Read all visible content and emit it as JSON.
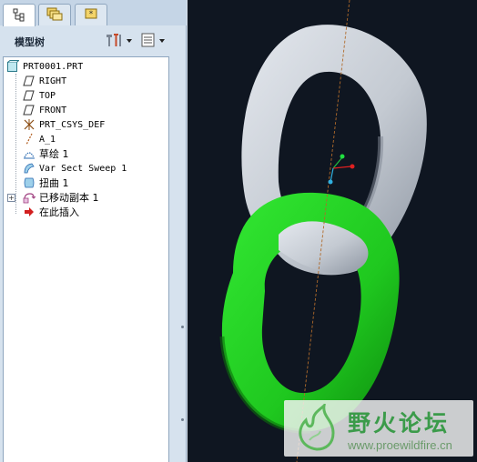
{
  "panel": {
    "title": "模型树",
    "tabs": [
      {
        "name": "model-tree-tab",
        "icon": "tree-icon"
      },
      {
        "name": "folder-browser-tab",
        "icon": "folders-icon"
      },
      {
        "name": "favorites-tab",
        "icon": "star-icon"
      }
    ]
  },
  "tree": {
    "items": [
      {
        "label": "PRT0001.PRT",
        "icon": "part-icon"
      },
      {
        "label": "RIGHT",
        "icon": "datum-plane-icon"
      },
      {
        "label": "TOP",
        "icon": "datum-plane-icon"
      },
      {
        "label": "FRONT",
        "icon": "datum-plane-icon"
      },
      {
        "label": "PRT_CSYS_DEF",
        "icon": "coordinate-system-icon"
      },
      {
        "label": "A_1",
        "icon": "datum-axis-icon"
      },
      {
        "label": "草绘 1",
        "icon": "sketch-icon"
      },
      {
        "label": "Var Sect Sweep 1",
        "icon": "sweep-icon"
      },
      {
        "label": "扭曲 1",
        "icon": "warp-icon"
      },
      {
        "label": "已移动副本 1",
        "icon": "moved-copy-icon"
      },
      {
        "label": "在此插入",
        "icon": "insert-here-arrow-icon"
      }
    ],
    "expander": "+"
  },
  "viewport": {
    "colors": {
      "background": "#0f1621",
      "gray_link": "#c9ced6",
      "green_link": "#1fd01f"
    }
  },
  "watermark": {
    "title": "野火论坛",
    "url": "www.proewildfire.cn",
    "color": "#3b9b4a"
  }
}
